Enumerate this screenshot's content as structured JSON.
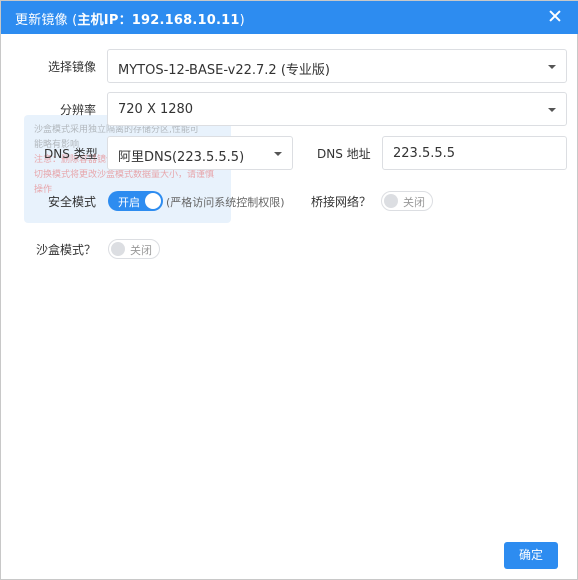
{
  "dialog": {
    "title_prefix": "更新镜像 (",
    "title_host": "主机IP：192.168.10.11",
    "title_suffix": ")"
  },
  "form": {
    "image_label": "选择镜像",
    "image_value": "MYTOS-12-BASE-v22.7.2 (专业版)",
    "resolution_label": "分辨率",
    "resolution_value": "720 X 1280",
    "dns_type_label": "DNS 类型",
    "dns_type_value": "阿里DNS(223.5.5.5)",
    "dns_addr_label": "DNS 地址",
    "dns_addr_value": "223.5.5.5",
    "safe_mode_label": "安全模式",
    "safe_mode_state": "开启",
    "safe_mode_hint": "(严格访问系统控制权限)",
    "bridge_label": "桥接网络？",
    "bridge_state": "关闭",
    "sandbox_label": "沙盒模式？",
    "sandbox_state": "关闭"
  },
  "tooltip": {
    "line1": "沙盒模式采用独立隔离的存储分区,性能可",
    "line2": "能略有影响",
    "line3": "注意：删除容器镜像时，沙盒数据会一并删除",
    "line4": "切换模式将更改沙盒模式数据量大小，请谨慎",
    "line5": "操作"
  },
  "footer": {
    "ok_label": "确定"
  },
  "colors": {
    "accent": "#2d8cf0",
    "border": "#dcdee2"
  }
}
